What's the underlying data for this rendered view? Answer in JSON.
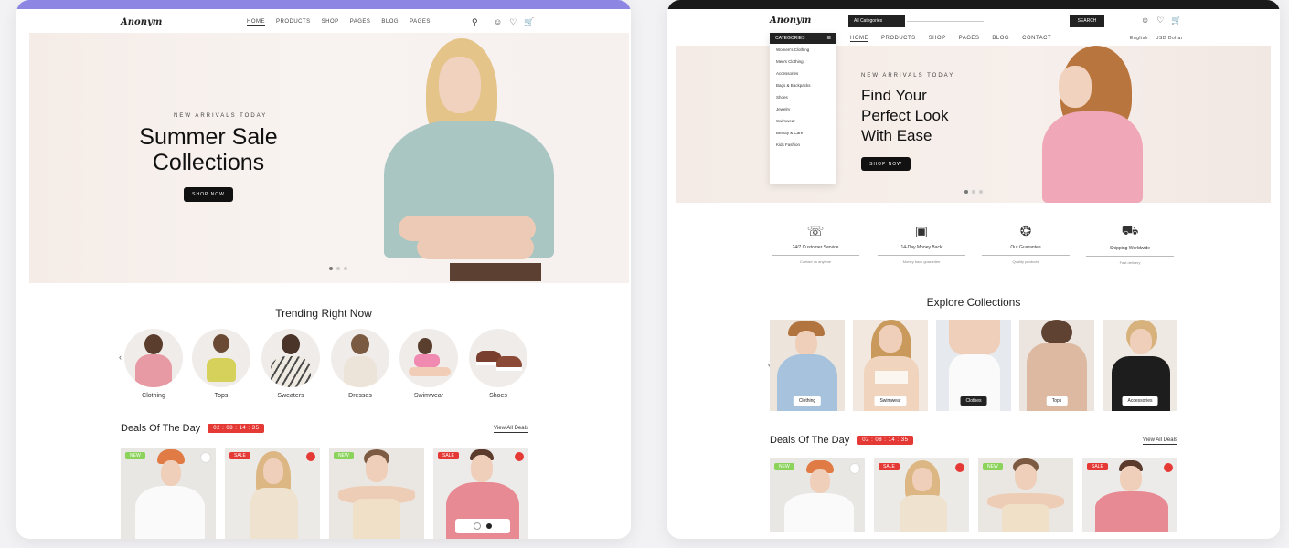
{
  "left": {
    "logo": "Anonym",
    "menu": [
      "HOME",
      "PRODUCTS",
      "SHOP",
      "PAGES",
      "BLOG",
      "PAGES"
    ],
    "hero": {
      "eyebrow": "NEW ARRIVALS TODAY",
      "title_line1": "Summer Sale",
      "title_line2": "Collections",
      "button": "SHOP NOW"
    },
    "trending": {
      "title": "Trending Right Now",
      "categories": [
        "Clothing",
        "Tops",
        "Sweaters",
        "Dresses",
        "Swimwear",
        "Shoes"
      ]
    },
    "deals": {
      "title": "Deals Of The Day",
      "countdown": "02 : 08 : 14 : 35",
      "view_all": "View All Deals",
      "badges": [
        "NEW",
        "SALE",
        "NEW",
        "SALE"
      ]
    }
  },
  "right": {
    "logo": "Anonym",
    "search_placeholder": "All Categories",
    "search_button": "SEARCH",
    "category_button": "CATEGORIES",
    "menu": [
      "HOME",
      "PRODUCTS",
      "SHOP",
      "PAGES",
      "BLOG",
      "CONTACT"
    ],
    "menu_right": [
      "English",
      "USD Dollar"
    ],
    "category_items": [
      "Women's Clothing",
      "Men's Clothing",
      "Accessories",
      "Bags & Backpacks",
      "Shoes",
      "Jewelry",
      "Swimwear",
      "Beauty & Care",
      "Kids Fashion"
    ],
    "hero": {
      "eyebrow": "NEW ARRIVALS TODAY",
      "title_line1": "Find Your",
      "title_line2": "Perfect Look",
      "title_line3": "With Ease",
      "button": "SHOP NOW"
    },
    "features": [
      {
        "title": "24/7 Customer Service",
        "sub": "Contact us anytime"
      },
      {
        "title": "14-Day Money Back",
        "sub": "Money back guarantee"
      },
      {
        "title": "Our Guarantee",
        "sub": "Quality products"
      },
      {
        "title": "Shipping Worldwide",
        "sub": "Fast delivery"
      }
    ],
    "collections": {
      "title": "Explore Collections",
      "items": [
        "Clothing",
        "Swimwear",
        "Clothes",
        "Tops",
        "Accessories"
      ]
    },
    "deals": {
      "title": "Deals Of The Day",
      "countdown": "02 : 08 : 14 : 35",
      "view_all": "View All Deals",
      "badges": [
        "NEW",
        "SALE",
        "NEW",
        "SALE"
      ]
    }
  },
  "colors": {
    "accent_purple": "#8e86e3",
    "sale_red": "#e53935",
    "new_green": "#8bd35b",
    "dark": "#111111"
  }
}
